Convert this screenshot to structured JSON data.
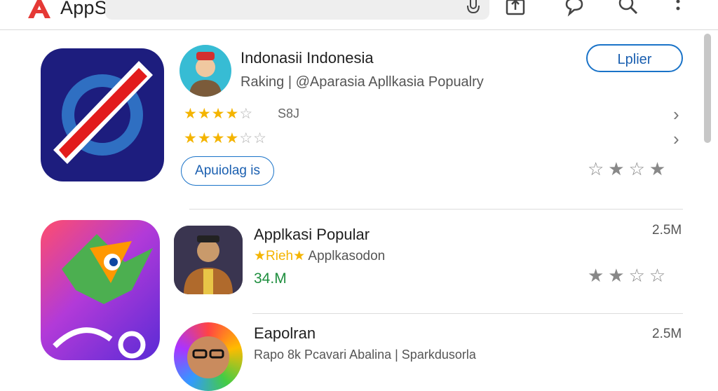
{
  "header": {
    "brand": "AppStorer"
  },
  "apps": [
    {
      "title": "Indonasii Indonesia",
      "subtitle": "Raking | @Aparasia Apllkasia Popualry",
      "stars_row1": 4.5,
      "count_row1": "S8J",
      "stars_row2": 4,
      "install_label": "Lplier",
      "chip_label": "Apuiolag is",
      "user_rating": 2.5
    },
    {
      "title": "Applkasi Popular",
      "subtitle_badge": "★Rieh★",
      "subtitle": "Applkasodon",
      "downloads": "34.M",
      "size": "2.5M",
      "user_rating": 2
    },
    {
      "title": "Eapolran",
      "subtitle": "Rapo 8k Pcavari Abalina | Sparkdusorla",
      "size": "2.5M"
    }
  ],
  "colors": {
    "accent": "#1a73c8",
    "star": "#f4b400",
    "green": "#1e8e3e"
  }
}
